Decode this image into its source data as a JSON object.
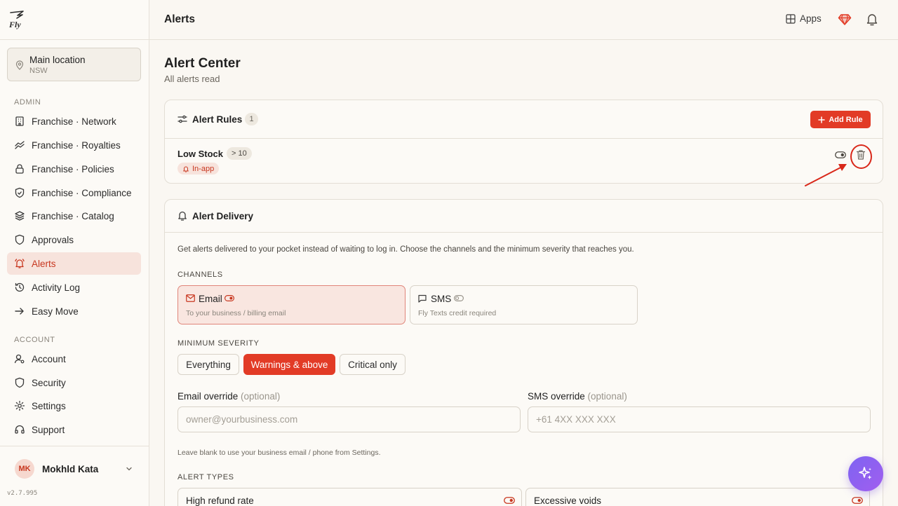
{
  "app": {
    "brand": "Fly"
  },
  "location": {
    "name": "Main location",
    "region": "NSW"
  },
  "sidebar": {
    "admin_label": "ADMIN",
    "admin_items": [
      {
        "label": "Franchise · Network",
        "icon": "building-icon"
      },
      {
        "label": "Franchise · Royalties",
        "icon": "coins-icon"
      },
      {
        "label": "Franchise · Policies",
        "icon": "lock-icon"
      },
      {
        "label": "Franchise · Compliance",
        "icon": "shield-check-icon"
      },
      {
        "label": "Franchise · Catalog",
        "icon": "layers-icon"
      },
      {
        "label": "Approvals",
        "icon": "shield-icon"
      },
      {
        "label": "Alerts",
        "icon": "bell-ring-icon",
        "active": true
      },
      {
        "label": "Activity Log",
        "icon": "history-icon"
      },
      {
        "label": "Easy Move",
        "icon": "arrow-right-icon"
      }
    ],
    "account_label": "ACCOUNT",
    "account_items": [
      {
        "label": "Account",
        "icon": "user-cog-icon"
      },
      {
        "label": "Security",
        "icon": "shield-icon"
      },
      {
        "label": "Settings",
        "icon": "gear-icon"
      },
      {
        "label": "Support",
        "icon": "headset-icon"
      }
    ]
  },
  "user": {
    "initials": "MK",
    "name": "Mokhld Kata"
  },
  "version": "v2.7.995",
  "topbar": {
    "title": "Alerts",
    "apps_label": "Apps"
  },
  "page": {
    "title": "Alert Center",
    "subtitle": "All alerts read"
  },
  "rules": {
    "title": "Alert Rules",
    "count": "1",
    "add_label": "Add Rule",
    "items": [
      {
        "name": "Low Stock",
        "condition": "> 10",
        "channel": "In-app",
        "enabled": true
      }
    ]
  },
  "delivery": {
    "title": "Alert Delivery",
    "description": "Get alerts delivered to your pocket instead of waiting to log in. Choose the channels and the minimum severity that reaches you.",
    "channels_label": "CHANNELS",
    "channels": [
      {
        "name": "Email",
        "desc": "To your business / billing email",
        "selected": true,
        "enabled": true
      },
      {
        "name": "SMS",
        "desc": "Fly Texts credit required",
        "selected": false,
        "enabled": false
      }
    ],
    "severity_label": "MINIMUM SEVERITY",
    "severities": [
      {
        "label": "Everything",
        "active": false
      },
      {
        "label": "Warnings & above",
        "active": true
      },
      {
        "label": "Critical only",
        "active": false
      }
    ],
    "email_override": {
      "label": "Email override",
      "optional": "(optional)",
      "placeholder": "owner@yourbusiness.com",
      "value": ""
    },
    "sms_override": {
      "label": "SMS override",
      "optional": "(optional)",
      "placeholder": "+61 4XX XXX XXX",
      "value": ""
    },
    "hint": "Leave blank to use your business email / phone from Settings.",
    "types_label": "ALERT TYPES",
    "types": [
      {
        "name": "High refund rate",
        "enabled": true
      },
      {
        "name": "Excessive voids",
        "enabled": true
      }
    ]
  },
  "colors": {
    "accent": "#e23b26",
    "active_bg": "#f7e3dc",
    "ai_fab": "#8a5ef0"
  }
}
